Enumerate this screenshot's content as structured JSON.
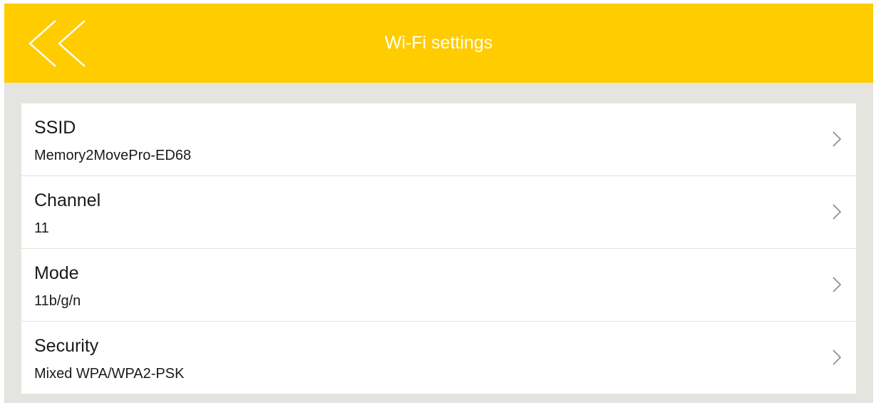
{
  "header": {
    "title": "Wi-Fi settings",
    "back_icon": "double-chevron-left-icon",
    "background_color": "#ffcc00",
    "title_color": "#ffffff"
  },
  "settings": {
    "rows": [
      {
        "label": "SSID",
        "value": "Memory2MovePro-ED68",
        "icon": "chevron-right-icon"
      },
      {
        "label": "Channel",
        "value": "11",
        "icon": "chevron-right-icon"
      },
      {
        "label": "Mode",
        "value": "11b/g/n",
        "icon": "chevron-right-icon"
      },
      {
        "label": "Security",
        "value": "Mixed WPA/WPA2-PSK",
        "icon": "chevron-right-icon"
      }
    ]
  }
}
